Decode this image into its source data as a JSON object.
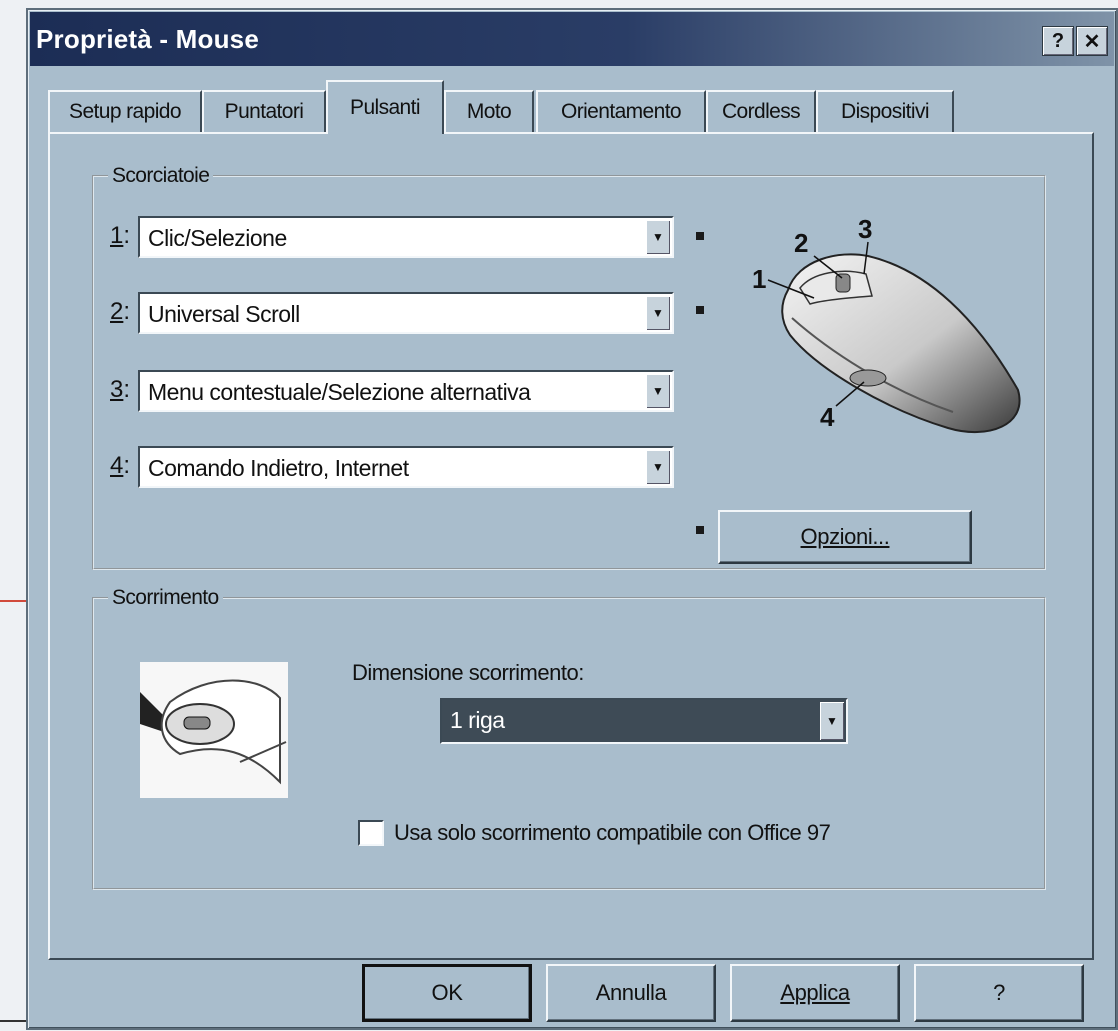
{
  "window": {
    "title": "Proprietà - Mouse",
    "help_button": "?",
    "close_button": "✕"
  },
  "tabs": [
    {
      "label": "Setup rapido",
      "active": false
    },
    {
      "label": "Puntatori",
      "active": false
    },
    {
      "label": "Pulsanti",
      "active": true
    },
    {
      "label": "Moto",
      "active": false
    },
    {
      "label": "Orientamento",
      "active": false
    },
    {
      "label": "Cordless",
      "active": false
    },
    {
      "label": "Dispositivi",
      "active": false
    }
  ],
  "shortcuts": {
    "legend": "Scorciatoie",
    "rows": [
      {
        "number": "1",
        "value": "Clic/Selezione"
      },
      {
        "number": "2",
        "value": "Universal Scroll"
      },
      {
        "number": "3",
        "value": "Menu contestuale/Selezione alternativa"
      },
      {
        "number": "4",
        "value": "Comando Indietro, Internet"
      }
    ],
    "options_button": "Opzioni...",
    "mouse_labels": [
      "1",
      "2",
      "3",
      "4"
    ]
  },
  "scrolling": {
    "legend": "Scorrimento",
    "size_label": "Dimensione scorrimento:",
    "size_value": "1 riga",
    "office_checkbox_label": "Usa solo scorrimento compatibile con Office 97",
    "office_checkbox_checked": false
  },
  "footer": {
    "ok": "OK",
    "cancel": "Annulla",
    "apply": "Applica",
    "help": "?"
  }
}
